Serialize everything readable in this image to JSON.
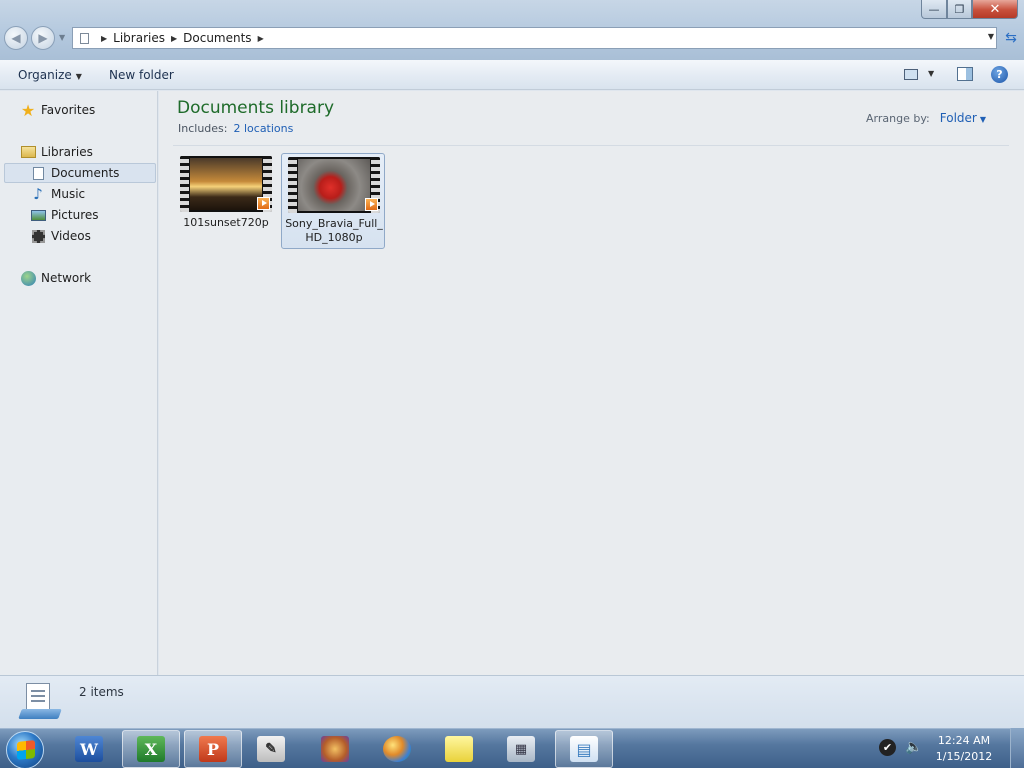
{
  "window": {
    "controls": {
      "minimize": "—",
      "maximize": "❐",
      "close": "✕"
    }
  },
  "address": {
    "crumbs": [
      "Libraries",
      "Documents"
    ]
  },
  "toolbar": {
    "organize_label": "Organize",
    "new_folder_label": "New folder"
  },
  "nav": {
    "favorites": "Favorites",
    "libraries": "Libraries",
    "documents": "Documents",
    "music": "Music",
    "pictures": "Pictures",
    "videos": "Videos",
    "network": "Network"
  },
  "content": {
    "title": "Documents library",
    "includes_label": "Includes:",
    "includes_link": "2 locations",
    "arrange_label": "Arrange by:",
    "arrange_value": "Folder",
    "files": [
      {
        "name": "101sunset720p",
        "selected": false
      },
      {
        "name": "Sony_Bravia_Full_HD_1080p",
        "selected": true
      }
    ]
  },
  "details": {
    "count": "2 items"
  },
  "taskbar": {
    "apps": [
      "word-icon",
      "excel-icon",
      "powerpoint-icon",
      "journal-icon",
      "media-icon",
      "paint-icon",
      "sticky-notes-icon",
      "calculator-icon",
      "explorer-icon"
    ],
    "clock_time": "12:24 AM",
    "clock_date": "1/15/2012"
  }
}
